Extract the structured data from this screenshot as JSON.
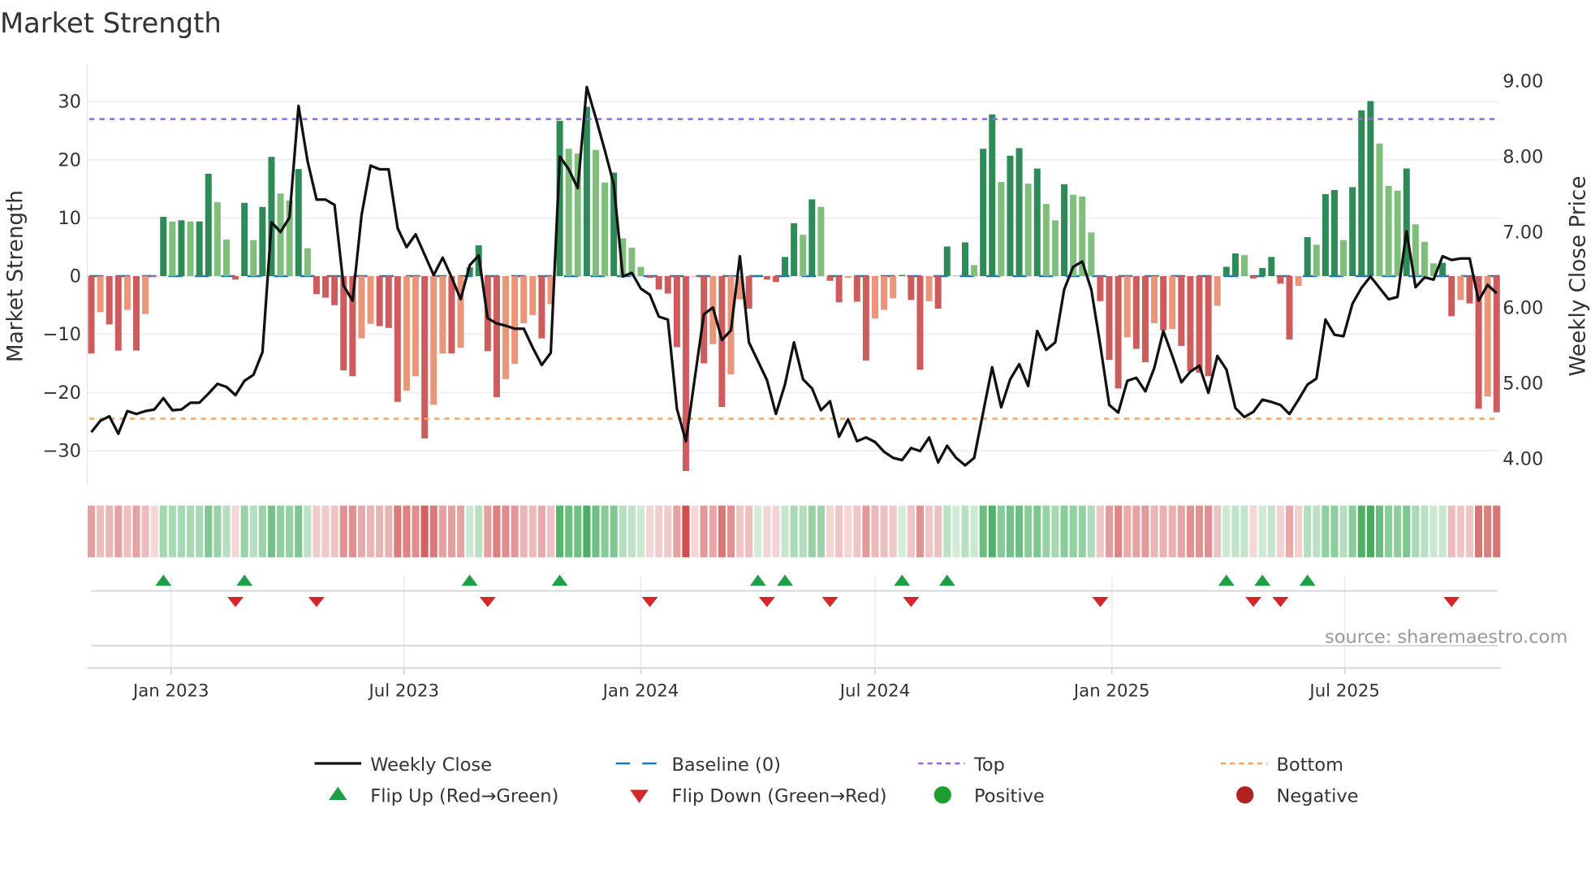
{
  "title": "Market Strength",
  "source": "source: sharemaestro.com",
  "colors": {
    "green_dark": "#2e8b57",
    "green_light": "#7fbf7b",
    "red_dark": "#cd5c5c",
    "red_light": "#e9967a",
    "baseline": "#1f77b4",
    "top": "#9467e0",
    "bottom": "#f4a460",
    "line": "#111111",
    "flip_up": "#1e9e45",
    "flip_down": "#d62728"
  },
  "chart_data": {
    "type": "bar",
    "title": "Market Strength",
    "ylabel": "Market Strength",
    "y2label": "Weekly Close Price",
    "ylim": [
      -36,
      36
    ],
    "y2lim": [
      3.84,
      9.3
    ],
    "yticks": [
      "30",
      "20",
      "10",
      "0",
      "−10",
      "−20",
      "−30"
    ],
    "ytick_values": [
      30,
      20,
      10,
      0,
      -10,
      -20,
      -30
    ],
    "y2ticks": [
      "9.00",
      "8.00",
      "7.00",
      "6.00",
      "5.00",
      "4.00"
    ],
    "y2tick_values": [
      9,
      8,
      7,
      6,
      5,
      4
    ],
    "xticks": [
      {
        "label": "Jan 2023",
        "date": "2023-01-01"
      },
      {
        "label": "Jul 2023",
        "date": "2023-07-01"
      },
      {
        "label": "Jan 2024",
        "date": "2024-01-01"
      },
      {
        "label": "Jul 2024",
        "date": "2024-07-01"
      },
      {
        "label": "Jan 2025",
        "date": "2025-01-01"
      },
      {
        "label": "Jul 2025",
        "date": "2025-07-01"
      }
    ],
    "start_date": "2022-10-31",
    "interval_days": 7,
    "top_level": 27,
    "bottom_level": -24.5,
    "baseline": 0,
    "strength": [
      -13.3,
      -6.2,
      -8.3,
      -12.8,
      -5.8,
      -12.8,
      -6.5,
      -0.1,
      10.2,
      9.4,
      9.6,
      9.4,
      9.4,
      17.6,
      12.7,
      6.3,
      -0.6,
      12.6,
      6.2,
      11.9,
      20.5,
      14.2,
      13.0,
      18.4,
      4.8,
      -3.1,
      -3.7,
      -5.0,
      -16.2,
      -17.2,
      -10.7,
      -8.2,
      -8.6,
      -8.9,
      -21.6,
      -19.7,
      -17.2,
      -27.9,
      -22.1,
      -13.3,
      -13.3,
      -12.3,
      1.5,
      5.3,
      -12.9,
      -20.8,
      -17.7,
      -15.1,
      -8.1,
      -6.7,
      -10.7,
      -4.8,
      26.7,
      21.9,
      21.1,
      29.1,
      21.7,
      16.1,
      17.8,
      6.5,
      4.9,
      1.6,
      -0.3,
      -2.3,
      -3.0,
      -12.2,
      -33.5,
      -0.1,
      -15.0,
      -11.7,
      -22.5,
      -16.9,
      -4.0,
      -5.6,
      0.2,
      -0.6,
      -1.0,
      3.3,
      9.1,
      7.1,
      13.2,
      11.9,
      -0.8,
      -4.5,
      -0.3,
      -4.4,
      -14.5,
      -7.3,
      -5.8,
      -3.8,
      0.2,
      -4.1,
      -16.1,
      -4.3,
      -5.6,
      5.1,
      0.1,
      5.8,
      1.9,
      21.9,
      27.8,
      16.2,
      20.7,
      22.0,
      15.9,
      18.5,
      12.4,
      9.6,
      15.8,
      14.0,
      13.7,
      7.5,
      -4.3,
      -14.4,
      -19.3,
      -10.5,
      -12.5,
      -14.8,
      -8.1,
      -9.3,
      -9.1,
      -12.0,
      -16.4,
      -16.6,
      -17.2,
      -5.1,
      1.6,
      3.9,
      3.6,
      -0.4,
      1.4,
      3.3,
      -1.3,
      -10.9,
      -1.7,
      6.7,
      5.4,
      14.1,
      14.8,
      6.2,
      15.3,
      28.5,
      30.1,
      22.8,
      15.5,
      14.7,
      18.5,
      8.9,
      5.9,
      2.2,
      2.3,
      -6.9,
      -4.1,
      -4.7,
      -22.8,
      -20.7,
      -23.4
    ],
    "close": [
      4.34,
      4.49,
      4.55,
      4.32,
      4.62,
      4.58,
      4.62,
      4.64,
      4.79,
      4.63,
      4.64,
      4.73,
      4.73,
      4.85,
      4.98,
      4.94,
      4.83,
      5.02,
      5.1,
      5.4,
      7.12,
      6.99,
      7.18,
      8.66,
      7.93,
      7.42,
      7.42,
      7.35,
      6.28,
      6.08,
      7.21,
      7.87,
      7.82,
      7.82,
      7.04,
      6.79,
      6.96,
      6.69,
      6.42,
      6.65,
      6.39,
      6.1,
      6.55,
      6.68,
      5.85,
      5.78,
      5.75,
      5.71,
      5.71,
      5.46,
      5.23,
      5.39,
      7.99,
      7.82,
      7.57,
      8.91,
      8.5,
      8.07,
      7.62,
      6.4,
      6.45,
      6.24,
      6.16,
      5.87,
      5.83,
      4.65,
      4.22,
      5.06,
      5.9,
      5.99,
      5.56,
      5.69,
      6.67,
      5.53,
      5.28,
      5.03,
      4.58,
      4.97,
      5.53,
      5.04,
      4.92,
      4.63,
      4.75,
      4.28,
      4.51,
      4.22,
      4.27,
      4.21,
      4.08,
      4.0,
      3.97,
      4.13,
      4.09,
      4.27,
      3.94,
      4.16,
      4.0,
      3.9,
      4.0,
      4.6,
      5.2,
      4.67,
      5.04,
      5.24,
      4.95,
      5.68,
      5.43,
      5.53,
      6.23,
      6.53,
      6.6,
      6.23,
      5.49,
      4.7,
      4.6,
      5.02,
      5.06,
      4.88,
      5.19,
      5.68,
      5.35,
      5.0,
      5.14,
      5.22,
      4.86,
      5.35,
      5.17,
      4.66,
      4.54,
      4.61,
      4.77,
      4.74,
      4.7,
      4.58,
      4.77,
      4.97,
      5.05,
      5.83,
      5.63,
      5.61,
      6.04,
      6.25,
      6.4,
      6.25,
      6.1,
      6.13,
      7.0,
      6.26,
      6.39,
      6.36,
      6.67,
      6.62,
      6.64,
      6.64,
      6.08,
      6.29,
      6.18
    ],
    "legend_position": "bottom-center",
    "grid": true
  },
  "legend": [
    {
      "label": "Weekly Close",
      "kind": "line"
    },
    {
      "label": "Baseline (0)",
      "kind": "baseline"
    },
    {
      "label": "Top",
      "kind": "top"
    },
    {
      "label": "Bottom",
      "kind": "bottom"
    },
    {
      "label": "Flip Up (Red→Green)",
      "kind": "up"
    },
    {
      "label": "Flip Down (Green→Red)",
      "kind": "down"
    },
    {
      "label": "Positive",
      "kind": "pos"
    },
    {
      "label": "Negative",
      "kind": "neg"
    }
  ]
}
